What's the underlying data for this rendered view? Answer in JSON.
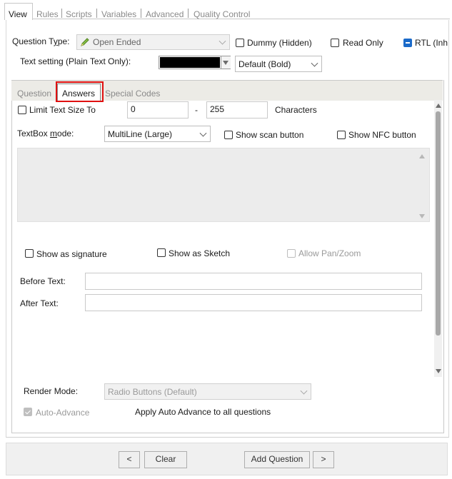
{
  "tabs": [
    "View",
    "Rules",
    "Scripts",
    "Variables",
    "Advanced",
    "Quality Control"
  ],
  "question_type": {
    "label": "Question Type:",
    "label_accel": "y",
    "label_pre": "Question T",
    "label_post": "pe:",
    "value": "Open Ended",
    "icon": "pencil-icon"
  },
  "dummy": {
    "label": "Dummy (Hidden)",
    "checked": false
  },
  "read_only": {
    "label": "Read Only",
    "checked": false
  },
  "rtl": {
    "label": "RTL (Inh",
    "checked": true
  },
  "text_setting": {
    "label": "Text setting (Plain Text Only):",
    "color": "#000000",
    "font_value": "Default (Bold)"
  },
  "subtabs": [
    "Question",
    "Answers",
    "Special Codes"
  ],
  "limit": {
    "label": "Limit Text Size To",
    "min": "0",
    "dash": "-",
    "max": "255",
    "unit": "Characters",
    "checked": false
  },
  "textbox_mode": {
    "label_pre": "TextBox ",
    "label_accel": "m",
    "label_post": "ode:",
    "value": "MultiLine (Large)"
  },
  "show_scan": {
    "label": "Show scan button",
    "checked": false
  },
  "show_nfc": {
    "label": "Show NFC button",
    "checked": false
  },
  "show_signature": {
    "label": "Show as signature",
    "checked": false
  },
  "show_sketch": {
    "label": "Show as Sketch",
    "checked": false
  },
  "allow_pan": {
    "label": "Allow Pan/Zoom",
    "checked": false,
    "disabled": true
  },
  "before_text": {
    "label": "Before Text:",
    "value": ""
  },
  "after_text": {
    "label": "After Text:",
    "value": ""
  },
  "render_mode": {
    "label": "Render Mode:",
    "value": "Radio Buttons (Default)"
  },
  "auto_advance": {
    "label": "Auto-Advance",
    "checked": true,
    "disabled": true
  },
  "apply_auto_advance": "Apply Auto Advance to all questions",
  "footer": {
    "prev": "<",
    "clear": "Clear",
    "add_question": "Add Question",
    "next": ">"
  },
  "colors": {
    "accent": "#1b6ac9",
    "highlight": "#e01010"
  }
}
